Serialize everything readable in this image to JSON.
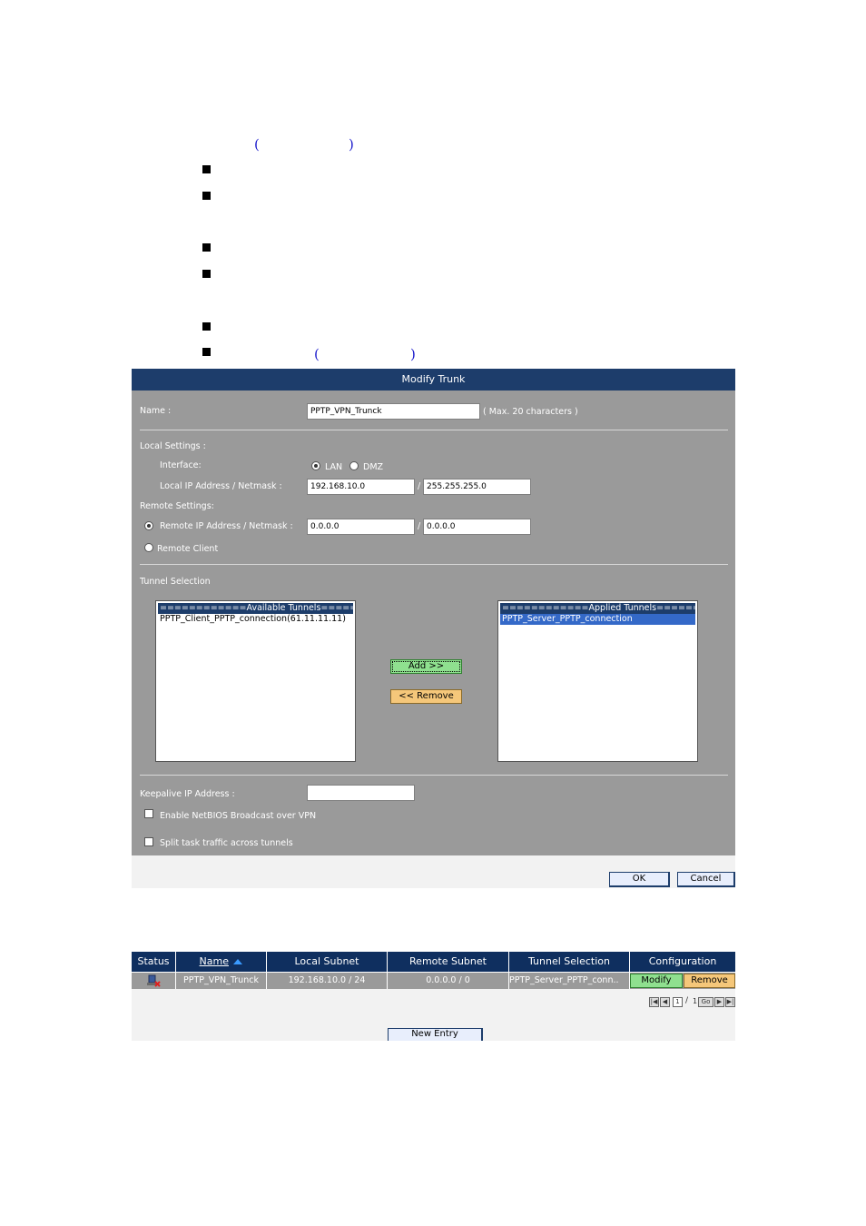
{
  "doc": {
    "parens": [
      "(",
      ")",
      "(",
      ")"
    ]
  },
  "panel": {
    "title": "Modify Trunk",
    "name_label": "Name :",
    "name_value": "PPTP_VPN_Trunck",
    "name_hint": "( Max. 20 characters )",
    "local_settings_label": "Local Settings :",
    "interface_label": "Interface:",
    "interface_lan": "LAN",
    "interface_dmz": "DMZ",
    "local_ip_label": "Local IP Address / Netmask :",
    "local_ip": "192.168.10.0",
    "local_netmask": "255.255.255.0",
    "slash": "/",
    "remote_settings_label": "Remote Settings:",
    "remote_ip_label": "Remote IP Address / Netmask :",
    "remote_ip": "0.0.0.0",
    "remote_netmask": "0.0.0.0",
    "remote_client_label": "Remote Client",
    "tunnel_selection_label": "Tunnel Selection",
    "available_header": "============Available Tunnels============",
    "available_items": [
      "PPTP_Client_PPTP_connection(61.11.11.11)"
    ],
    "applied_header": "============Applied Tunnels=============",
    "applied_items": [
      "PPTP_Server_PPTP_connection"
    ],
    "add_button": "Add >>",
    "remove_button": "<< Remove",
    "keepalive_label": "Keepalive IP Address :",
    "keepalive_value": "",
    "netbios_label": "Enable NetBIOS Broadcast over VPN",
    "split_label": "Split task traffic across tunnels",
    "ok_button": "OK",
    "cancel_button": "Cancel"
  },
  "table": {
    "headers": [
      "Status",
      "Name",
      "Local Subnet",
      "Remote Subnet",
      "Tunnel Selection",
      "Configuration"
    ],
    "rows": [
      {
        "name": "PPTP_VPN_Trunck",
        "local_subnet": "192.168.10.0 / 24",
        "remote_subnet": "0.0.0.0 / 0",
        "tunnel_selection": "PPTP_Server_PPTP_conn..",
        "modify": "Modify",
        "remove": "Remove"
      }
    ],
    "page_current": "1",
    "page_sep": "/",
    "page_total": "1",
    "go_label": "Go",
    "new_entry_button": "New Entry"
  },
  "colors": {
    "header_bg": "#1d3d6b",
    "panel_bg": "#9a9a9a",
    "add_green": "#8fe08f",
    "remove_orange": "#f5c77a"
  }
}
